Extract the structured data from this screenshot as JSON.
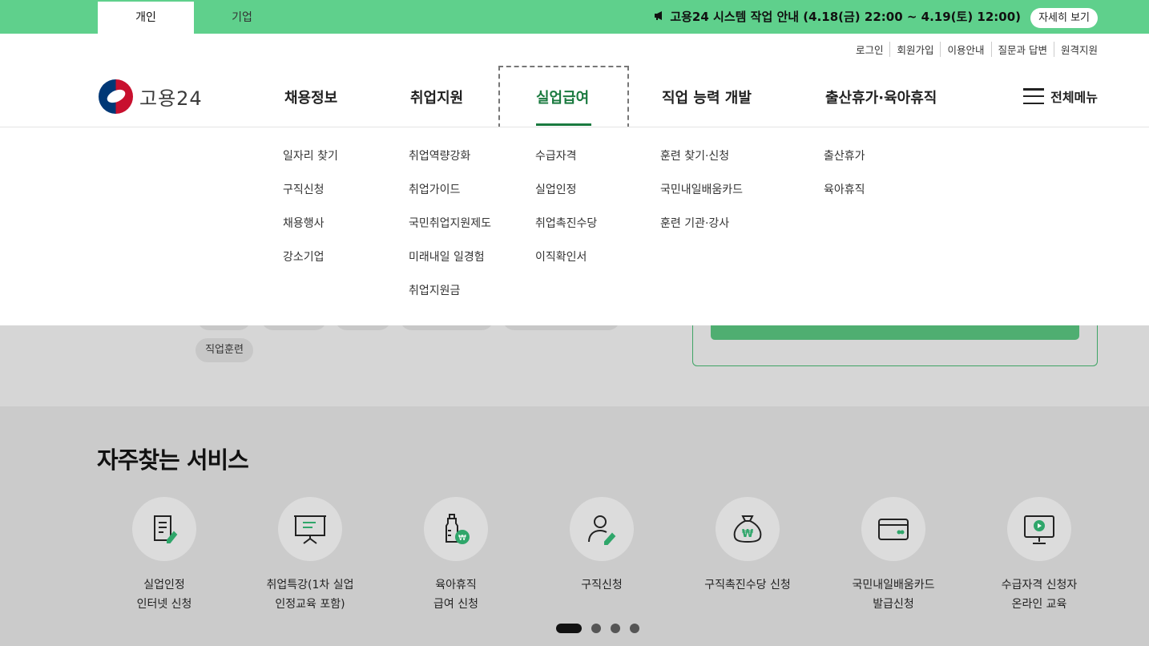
{
  "top_tabs": {
    "personal": "개인",
    "business": "기업"
  },
  "notice": {
    "text": "고용24 시스템 작업 안내 (4.18(금) 22:00 ~ 4.19(토) 12:00)",
    "button": "자세히 보기",
    "icon": "megaphone-icon"
  },
  "util_links": [
    "로그인",
    "회원가입",
    "이용안내",
    "질문과 답변",
    "원격지원"
  ],
  "logo": {
    "text": "고용24"
  },
  "gnb": [
    "채용정보",
    "취업지원",
    "실업급여",
    "직업 능력 개발",
    "출산휴가·육아휴직"
  ],
  "gnb_active": "실업급여",
  "all_menu": "전체메뉴",
  "dropdown": {
    "col1": [
      "일자리 찾기",
      "구직신청",
      "채용행사",
      "강소기업"
    ],
    "col2": [
      "취업역량강화",
      "취업가이드",
      "국민취업지원제도",
      "미래내일 일경험",
      "취업지원금"
    ],
    "col3": [
      "수급자격",
      "실업인정",
      "취업촉진수당",
      "이직확인서"
    ],
    "col4": [
      "훈련 찾기·신청",
      "국민내일배움카드",
      "훈련 기관·강사"
    ],
    "col5": [
      "출산휴가",
      "육아휴직"
    ]
  },
  "chip_visible": "직업훈련",
  "services": {
    "title": "자주찾는 서비스",
    "items": [
      {
        "line1": "실업인정",
        "line2": "인터넷 신청",
        "icon": "document-edit-icon"
      },
      {
        "line1": "취업특강(1차 실업",
        "line2": "인정교육 포함)",
        "icon": "presentation-board-icon"
      },
      {
        "line1": "육아휴직",
        "line2": "급여 신청",
        "icon": "baby-bottle-icon"
      },
      {
        "line1": "구직신청",
        "line2": "",
        "icon": "person-edit-icon"
      },
      {
        "line1": "구직촉진수당 신청",
        "line2": "",
        "icon": "money-bag-icon"
      },
      {
        "line1": "국민내일배움카드",
        "line2": "발급신청",
        "icon": "card-icon"
      },
      {
        "line1": "수급자격 신청자",
        "line2": "온라인 교육",
        "icon": "monitor-play-icon"
      }
    ]
  },
  "colors": {
    "brand_green": "#5fd08c",
    "active_green": "#1a7a3f",
    "icon_green": "#2fa66a"
  }
}
